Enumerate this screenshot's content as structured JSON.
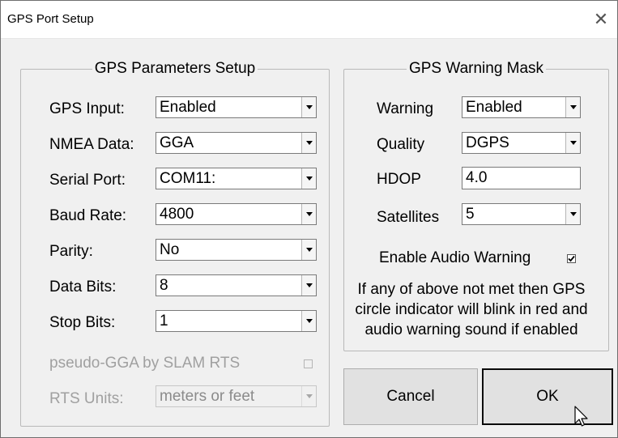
{
  "window": {
    "title": "GPS Port Setup",
    "close_symbol": "✕"
  },
  "params": {
    "title": "GPS Parameters Setup",
    "rows": [
      {
        "label": "GPS Input:",
        "value": "Enabled"
      },
      {
        "label": "NMEA Data:",
        "value": "GGA"
      },
      {
        "label": "Serial Port:",
        "value": "COM11:"
      },
      {
        "label": "Baud Rate:",
        "value": "4800"
      },
      {
        "label": "Parity:",
        "value": "No"
      },
      {
        "label": "Data Bits:",
        "value": "8"
      },
      {
        "label": "Stop Bits:",
        "value": "1"
      }
    ],
    "pseudo_gga_label": "pseudo-GGA by SLAM RTS",
    "pseudo_gga_checked": false,
    "rts_units_label": "RTS Units:",
    "rts_units_value": "meters or feet"
  },
  "warning_mask": {
    "title": "GPS Warning Mask",
    "warning_label": "Warning",
    "warning_value": "Enabled",
    "quality_label": "Quality",
    "quality_value": "DGPS",
    "hdop_label": "HDOP",
    "hdop_value": "4.0",
    "satellites_label": "Satellites",
    "satellites_value": "5",
    "audio_label": "Enable Audio Warning",
    "audio_checked": true,
    "note": "If any of above not met then GPS circle indicator will blink in red and audio warning sound if enabled"
  },
  "buttons": {
    "cancel": "Cancel",
    "ok": "OK"
  }
}
